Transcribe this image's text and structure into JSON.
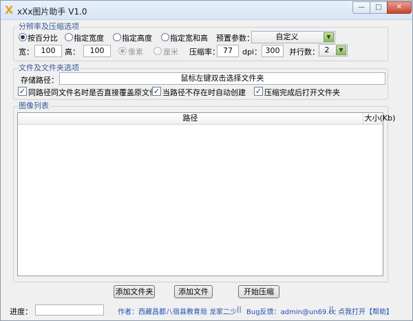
{
  "window": {
    "title": "xXx图片助手 V1.0",
    "icon_glyph": "X"
  },
  "window_controls": {
    "minimize": "—",
    "maximize": "□",
    "close": "✕"
  },
  "resolution_group": {
    "legend": "分辨率及压缩选项",
    "modes": [
      {
        "label": "按百分比",
        "selected": true
      },
      {
        "label": "指定宽度",
        "selected": false
      },
      {
        "label": "指定高度",
        "selected": false
      },
      {
        "label": "指定宽和高",
        "selected": false
      }
    ],
    "preset_label": "预置参数：",
    "preset_value": "自定义",
    "width_label": "宽：",
    "width_value": "100",
    "height_label": "高：",
    "height_value": "100",
    "unit_pixel": "像素",
    "unit_cm": "厘米",
    "compression_label": "压缩率：",
    "compression_value": "77",
    "dpi_label": "dpi：",
    "dpi_value": "300",
    "threads_label": "并行数：",
    "threads_value": "2"
  },
  "file_group": {
    "legend": "文件及文件夹选项",
    "save_path_label": "存储路径：",
    "save_path_placeholder": "鼠标左键双击选择文件夹",
    "options": [
      {
        "label": "同路径同文件名时是否直接覆盖原文件",
        "checked": true
      },
      {
        "label": "当路径不存在时自动创建",
        "checked": true
      },
      {
        "label": "压缩完成后打开文件夹",
        "checked": true
      }
    ]
  },
  "image_list": {
    "legend": "图像列表",
    "columns": {
      "path": "路径",
      "size": "大小(Kb)"
    }
  },
  "buttons": {
    "add_folder": "添加文件夹",
    "add_file": "添加文件",
    "start": "开始压缩"
  },
  "status": {
    "progress_label": "进度：",
    "author": "作者：西藏昌都八宿县教育局 龙家二少",
    "separator": "||",
    "feedback": "Bug反馈：admin@un69.cc",
    "help": "点我打开【帮助】"
  }
}
